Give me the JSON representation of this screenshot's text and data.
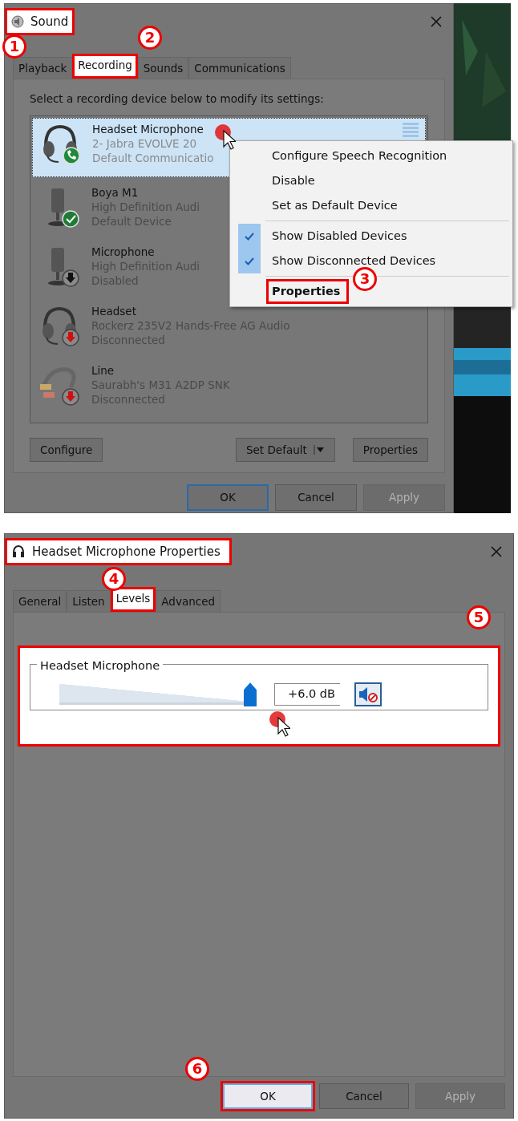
{
  "sound_dialog": {
    "title": "Sound",
    "title_highlighted": true,
    "tabs": [
      {
        "label": "Playback",
        "selected": false,
        "highlighted": false
      },
      {
        "label": "Recording",
        "selected": true,
        "highlighted": true
      },
      {
        "label": "Sounds",
        "selected": false,
        "highlighted": false
      },
      {
        "label": "Communications",
        "selected": false,
        "highlighted": false
      }
    ],
    "instruction": "Select a recording device below to modify its settings:",
    "devices": [
      {
        "name": "Headset Microphone",
        "detail": "2- Jabra EVOLVE 20",
        "status": "Default Communicatio",
        "kind": "headset",
        "badge": {
          "kind": "call"
        },
        "selected": true
      },
      {
        "name": "Boya M1",
        "detail": "High Definition Audi",
        "status": "Default Device",
        "kind": "mic",
        "badge": {
          "kind": "check"
        },
        "selected": false
      },
      {
        "name": "Microphone",
        "detail": "High Definition Audi",
        "status": "Disabled",
        "kind": "mic",
        "badge": {
          "kind": "disabled"
        },
        "selected": false
      },
      {
        "name": "Headset",
        "detail": "Rockerz 235V2 Hands-Free AG Audio",
        "status": "Disconnected",
        "kind": "headset",
        "badge": {
          "kind": "disconnected"
        },
        "selected": false
      },
      {
        "name": "Line",
        "detail": "Saurabh's M31 A2DP SNK",
        "status": "Disconnected",
        "kind": "line",
        "badge": {
          "kind": "disconnected"
        },
        "selected": false
      }
    ],
    "context_menu": {
      "groups": [
        [
          {
            "label": "Configure Speech Recognition",
            "checked": false,
            "bold": false,
            "highlighted": false
          },
          {
            "label": "Disable",
            "checked": false,
            "bold": false,
            "highlighted": false
          },
          {
            "label": "Set as Default Device",
            "checked": false,
            "bold": false,
            "highlighted": false
          }
        ],
        [
          {
            "label": "Show Disabled Devices",
            "checked": true,
            "bold": false,
            "highlighted": false
          },
          {
            "label": "Show Disconnected Devices",
            "checked": true,
            "bold": false,
            "highlighted": false
          }
        ],
        [
          {
            "label": "Properties",
            "checked": false,
            "bold": true,
            "highlighted": true
          }
        ]
      ]
    },
    "buttons": [
      {
        "label": "Configure",
        "kind": "plain"
      },
      {
        "label": "Set Default",
        "kind": "split"
      },
      {
        "label": "Properties",
        "kind": "plain"
      }
    ],
    "footer_buttons": [
      {
        "label": "OK",
        "default": true,
        "disabled": false,
        "highlighted": false
      },
      {
        "label": "Cancel",
        "default": false,
        "disabled": false,
        "highlighted": false
      },
      {
        "label": "Apply",
        "default": false,
        "disabled": true,
        "highlighted": false
      }
    ]
  },
  "properties_dialog": {
    "title": "Headset Microphone Properties",
    "title_highlighted": true,
    "tabs": [
      {
        "label": "General",
        "selected": false,
        "highlighted": false
      },
      {
        "label": "Listen",
        "selected": false,
        "highlighted": false
      },
      {
        "label": "Levels",
        "selected": true,
        "highlighted": true
      },
      {
        "label": "Advanced",
        "selected": false,
        "highlighted": false
      }
    ],
    "level_group": {
      "title": "Headset Microphone",
      "level": 1,
      "reading": "+6.0 dB",
      "muted": true,
      "highlighted": true
    },
    "footer_buttons": [
      {
        "label": "OK",
        "default": true,
        "disabled": false,
        "highlighted": true
      },
      {
        "label": "Cancel",
        "default": false,
        "disabled": false,
        "highlighted": false
      },
      {
        "label": "Apply",
        "default": false,
        "disabled": true,
        "highlighted": false
      }
    ]
  },
  "steps": [
    {
      "number": "1"
    },
    {
      "number": "2"
    },
    {
      "number": "3"
    },
    {
      "number": "4"
    },
    {
      "number": "5"
    },
    {
      "number": "6"
    }
  ]
}
